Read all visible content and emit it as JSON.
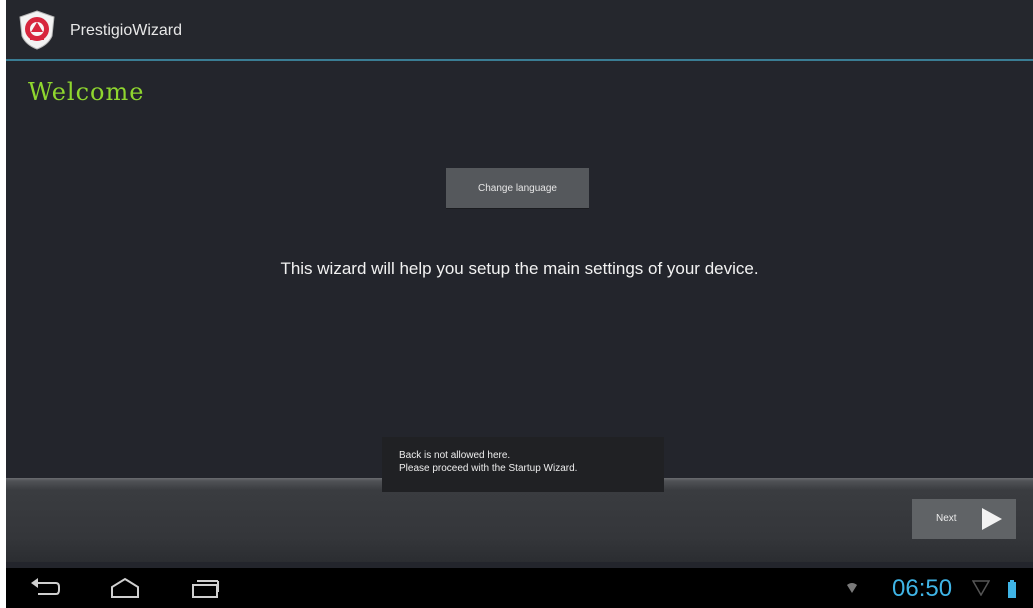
{
  "app": {
    "title": "PrestigioWizard"
  },
  "page": {
    "heading": "Welcome",
    "change_language_label": "Change language",
    "message": "This wizard will help you setup the main settings of your device."
  },
  "toast": {
    "line1": "Back is not allowed here.",
    "line2": "Please proceed with the Startup Wizard."
  },
  "wizard_bar": {
    "next_label": "Next",
    "next_icon": "play-arrow-icon"
  },
  "nav_bar": {
    "back_icon": "back-icon",
    "home_icon": "home-icon",
    "recents_icon": "recent-apps-icon"
  },
  "status": {
    "clock": "06:50",
    "wifi_icon": "wifi-icon",
    "signal_icon": "signal-icon",
    "battery_icon": "battery-icon"
  },
  "colors": {
    "accent_green": "#8fd62f",
    "clock_blue": "#3fb4e6",
    "action_bar_divider": "#3a7d94",
    "background": "#23252c"
  }
}
